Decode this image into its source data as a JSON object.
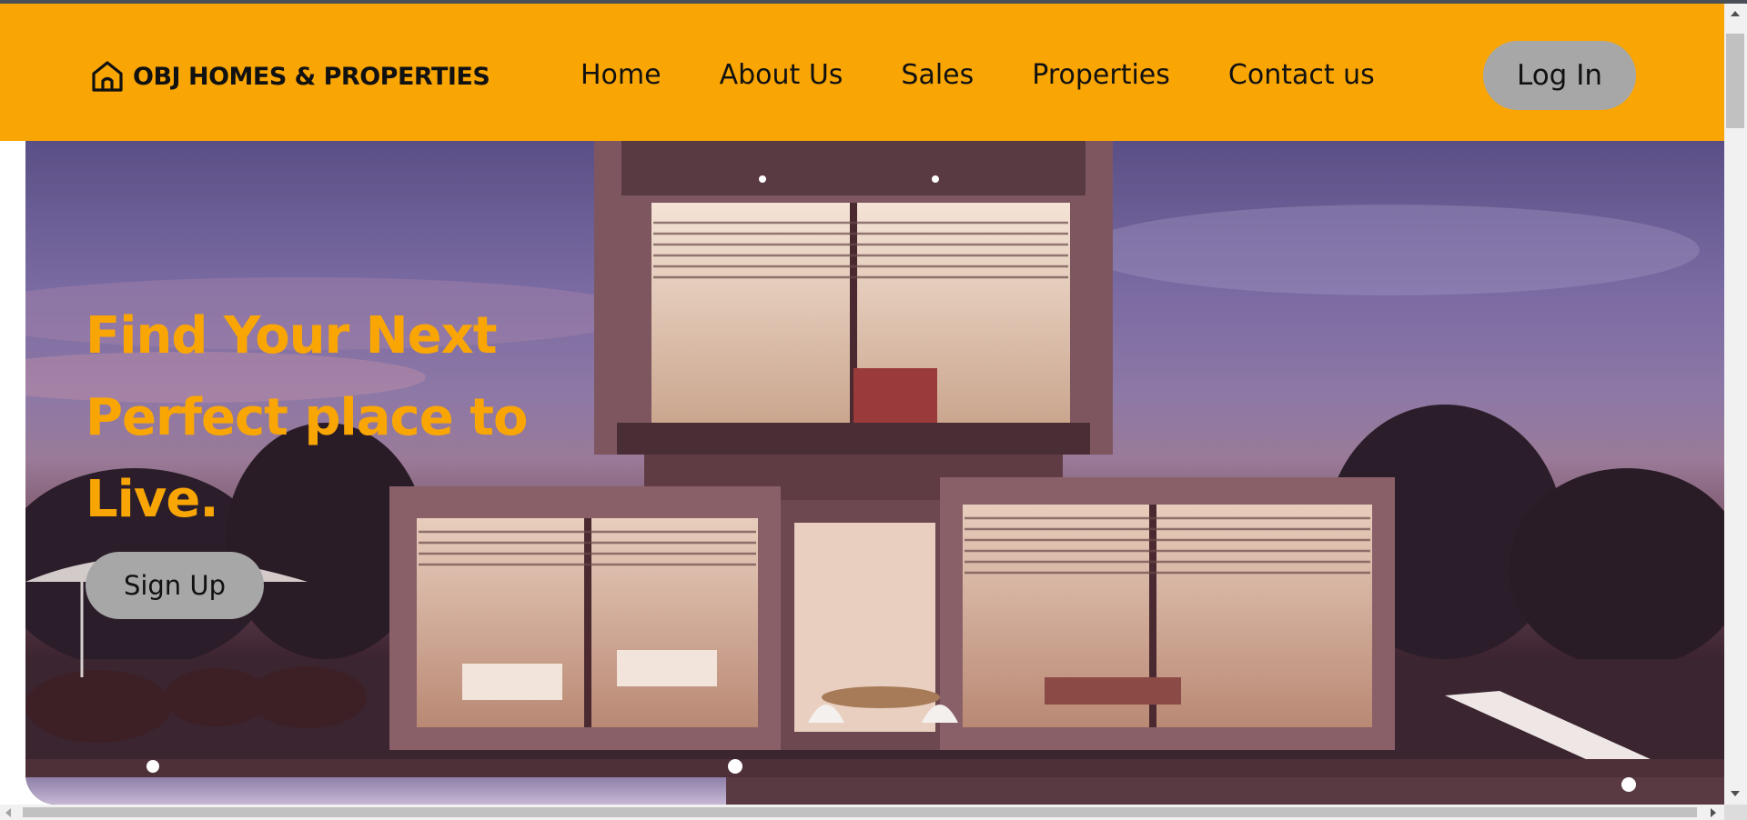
{
  "brand": {
    "icon": "home-icon",
    "name": "OBJ HOMES & PROPERTIES"
  },
  "nav": {
    "items": [
      {
        "label": "Home"
      },
      {
        "label": "About Us"
      },
      {
        "label": "Sales"
      },
      {
        "label": "Properties"
      },
      {
        "label": "Contact us"
      }
    ]
  },
  "header": {
    "login_label": "Log In"
  },
  "hero": {
    "title": "Find Your Next Perfect place to Live.",
    "signup_label": "Sign Up",
    "image": "modern-house-at-dusk"
  },
  "colors": {
    "accent": "#f9a605",
    "button": "#a7a7a7",
    "text": "#111111"
  }
}
